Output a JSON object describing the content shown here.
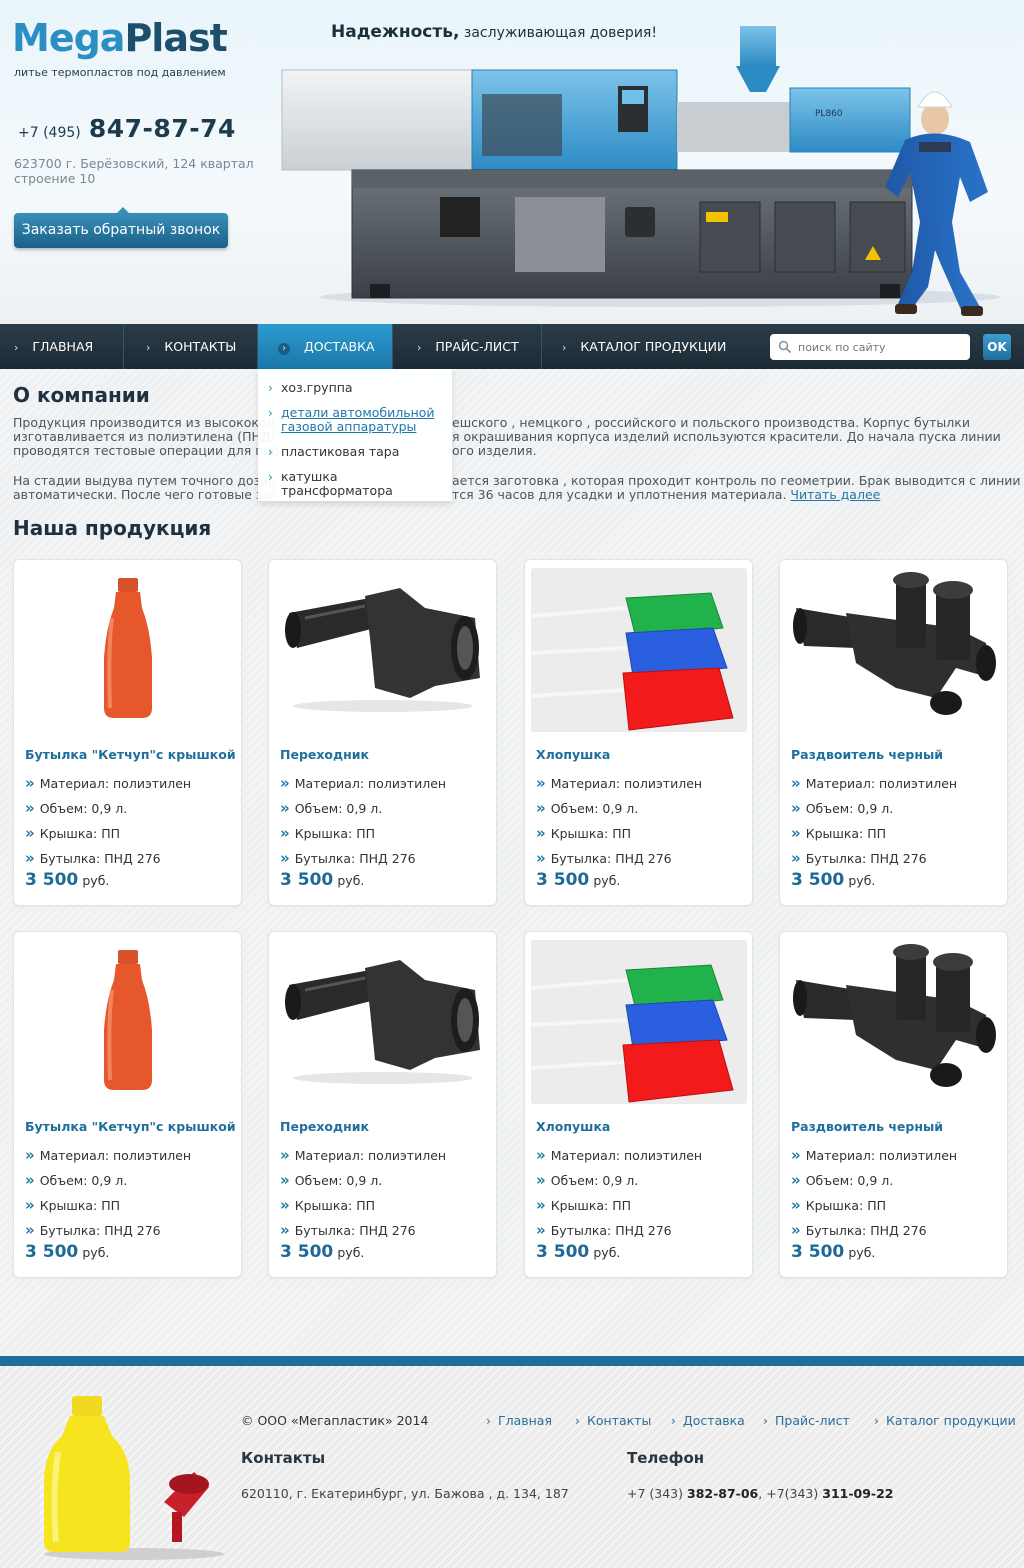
{
  "header": {
    "logo_part1": "Mega",
    "logo_part2": "Plast",
    "tagline": "литье термопластов под давлением",
    "phone_code": "+7 (495)",
    "phone_number": "847-87-74",
    "address": "623700 г. Берёзовский, 124 квартал строение 10",
    "callback_label": "Заказать обратный звонок",
    "slogan_bold": "Надежность,",
    "slogan_rest": "заслуживающая доверия!",
    "machine_label": "PL860"
  },
  "nav": {
    "items": [
      {
        "label": "ГЛАВНАЯ"
      },
      {
        "label": "КОНТАКТЫ"
      },
      {
        "label": "ДОСТАВКА"
      },
      {
        "label": "ПРАЙС-ЛИСТ"
      },
      {
        "label": "КАТАЛОГ ПРОДУКЦИИ"
      }
    ],
    "active_index": 2,
    "search_placeholder": "поиск по сайту",
    "search_button": "OK"
  },
  "dropdown": {
    "items": [
      {
        "label": "хоз.группа"
      },
      {
        "label": "детали автомобильной газовой аппаратуры"
      },
      {
        "label": "пластиковая тара"
      },
      {
        "label": "катушка трансформатора"
      }
    ]
  },
  "about": {
    "title": "О компании",
    "p1_line1": "Продукция производится из высококол",
    "p1_line1_tail": "ешского , немцкого , российского и польского производства. Корпус бутылки",
    "p1_line2": "изготавливается из полиэтилена (ПНД)",
    "p1_line2_tail": "я окрашивания корпуса изделий используются красители. До начала пуска линии",
    "p1_line3": "проводятся тестовые операции для про",
    "p1_line3_tail": "ого изделия.",
    "p2_line1": "На стадии выдува путем точного дозир",
    "p2_line1_tail": "ается заготовка , которая проходит контроль по геометрии. Брак выводится с линии",
    "p2_line2": "автоматически. После чего готовые заг",
    "p2_line2_tail": "тся 36 часов для усадки и уплотнения материала.",
    "read_more": "Читать далее"
  },
  "products_title": "Наша продукция",
  "products": [
    {
      "name": "Бутылка \"Кетчуп\"с крышкой",
      "specs": [
        "Материал: полиэтилен",
        "Объем: 0,9 л.",
        "Крышка: ПП",
        "Бутылка: ПНД 276"
      ],
      "price": "3 500",
      "currency": "руб.",
      "image": "bottle"
    },
    {
      "name": "Переходник",
      "specs": [
        "Материал: полиэтилен",
        "Объем: 0,9 л.",
        "Крышка: ПП",
        "Бутылка: ПНД 276"
      ],
      "price": "3 500",
      "currency": "руб.",
      "image": "adapter"
    },
    {
      "name": "Хлопушка",
      "specs": [
        "Материал: полиэтилен",
        "Объем: 0,9 л.",
        "Крышка: ПП",
        "Бутылка: ПНД 276"
      ],
      "price": "3 500",
      "currency": "руб.",
      "image": "swatters"
    },
    {
      "name": "Раздвоитель черный",
      "specs": [
        "Материал: полиэтилен",
        "Объем: 0,9 л.",
        "Крышка: ПП",
        "Бутылка: ПНД 276"
      ],
      "price": "3 500",
      "currency": "руб.",
      "image": "splitter"
    },
    {
      "name": "Бутылка \"Кетчуп\"с крышкой",
      "specs": [
        "Материал: полиэтилен",
        "Объем: 0,9 л.",
        "Крышка: ПП",
        "Бутылка: ПНД 276"
      ],
      "price": "3 500",
      "currency": "руб.",
      "image": "bottle"
    },
    {
      "name": "Переходник",
      "specs": [
        "Материал: полиэтилен",
        "Объем: 0,9 л.",
        "Крышка: ПП",
        "Бутылка: ПНД 276"
      ],
      "price": "3 500",
      "currency": "руб.",
      "image": "adapter"
    },
    {
      "name": "Хлопушка",
      "specs": [
        "Материал: полиэтилен",
        "Объем: 0,9 л.",
        "Крышка: ПП",
        "Бутылка: ПНД 276"
      ],
      "price": "3 500",
      "currency": "руб.",
      "image": "swatters"
    },
    {
      "name": "Раздвоитель черный",
      "specs": [
        "Материал: полиэтилен",
        "Объем: 0,9 л.",
        "Крышка: ПП",
        "Бутылка: ПНД 276"
      ],
      "price": "3 500",
      "currency": "руб.",
      "image": "splitter"
    }
  ],
  "spec_bullet": "»",
  "footer": {
    "copyright": "© ООО «Мегапластик» 2014",
    "links": [
      {
        "label": "Главная"
      },
      {
        "label": "Контакты"
      },
      {
        "label": "Доставка"
      },
      {
        "label": "Прайс-лист"
      },
      {
        "label": "Каталог продукции"
      }
    ],
    "contacts_title": "Контакты",
    "address": "620110, г. Екатеринбург, ул. Бажова , д. 134, 187",
    "phone_title": "Телефон",
    "phone1_code": "+7 (343)",
    "phone1_num": "382-87-06",
    "phone2_code": "+7(343)",
    "phone2_num": "311-09-22"
  },
  "colors": {
    "accent": "#1f6f9d",
    "nav_bg": "#1c2a34",
    "nav_active": "#1b77a9",
    "footer_bar": "#1f6f9a"
  }
}
